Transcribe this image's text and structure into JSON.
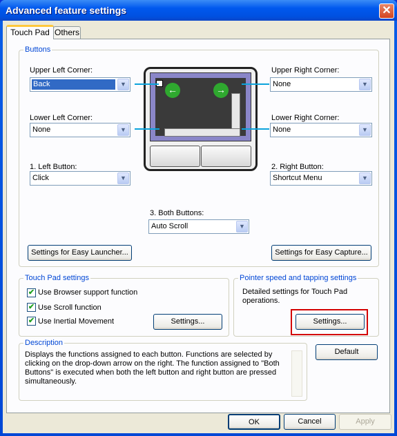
{
  "window": {
    "title": "Advanced feature settings"
  },
  "tabs": [
    {
      "label": "Touch Pad",
      "selected": true
    },
    {
      "label": "Others",
      "selected": false
    }
  ],
  "buttons_group": {
    "label": "Buttons",
    "upper_left": {
      "label": "Upper Left Corner:",
      "value": "Back"
    },
    "upper_right": {
      "label": "Upper Right Corner:",
      "value": "None"
    },
    "lower_left": {
      "label": "Lower Left Corner:",
      "value": "None"
    },
    "lower_right": {
      "label": "Lower Right Corner:",
      "value": "None"
    },
    "left_button": {
      "label": "1. Left Button:",
      "value": "Click"
    },
    "right_button": {
      "label": "2. Right Button:",
      "value": "Shortcut Menu"
    },
    "both_buttons": {
      "label": "3. Both Buttons:",
      "value": "Auto Scroll"
    },
    "easy_launcher": "Settings for Easy Launcher...",
    "easy_capture": "Settings for Easy Capture..."
  },
  "touchpad_settings": {
    "label": "Touch Pad settings",
    "checkboxes": [
      {
        "label": "Use Browser support function",
        "checked": true
      },
      {
        "label": "Use Scroll function",
        "checked": true
      },
      {
        "label": "Use Inertial Movement",
        "checked": true
      }
    ],
    "settings_button": "Settings..."
  },
  "pointer_settings": {
    "label": "Pointer speed and tapping settings",
    "text": "Detailed settings for Touch Pad operations.",
    "settings_button": "Settings...",
    "highlight_color": "#d40000"
  },
  "description": {
    "label": "Description",
    "text": "Displays the functions assigned to each button. Functions are selected by clicking on the drop-down arrow on the right. The function assigned to \"Both Buttons\" is executed when both the left button and right button are pressed simultaneously."
  },
  "default_button": "Default",
  "footer": {
    "ok": "OK",
    "cancel": "Cancel",
    "apply": "Apply",
    "apply_enabled": false
  },
  "icons": {
    "close": "✕",
    "dropdown": "▼",
    "check": "✔"
  }
}
